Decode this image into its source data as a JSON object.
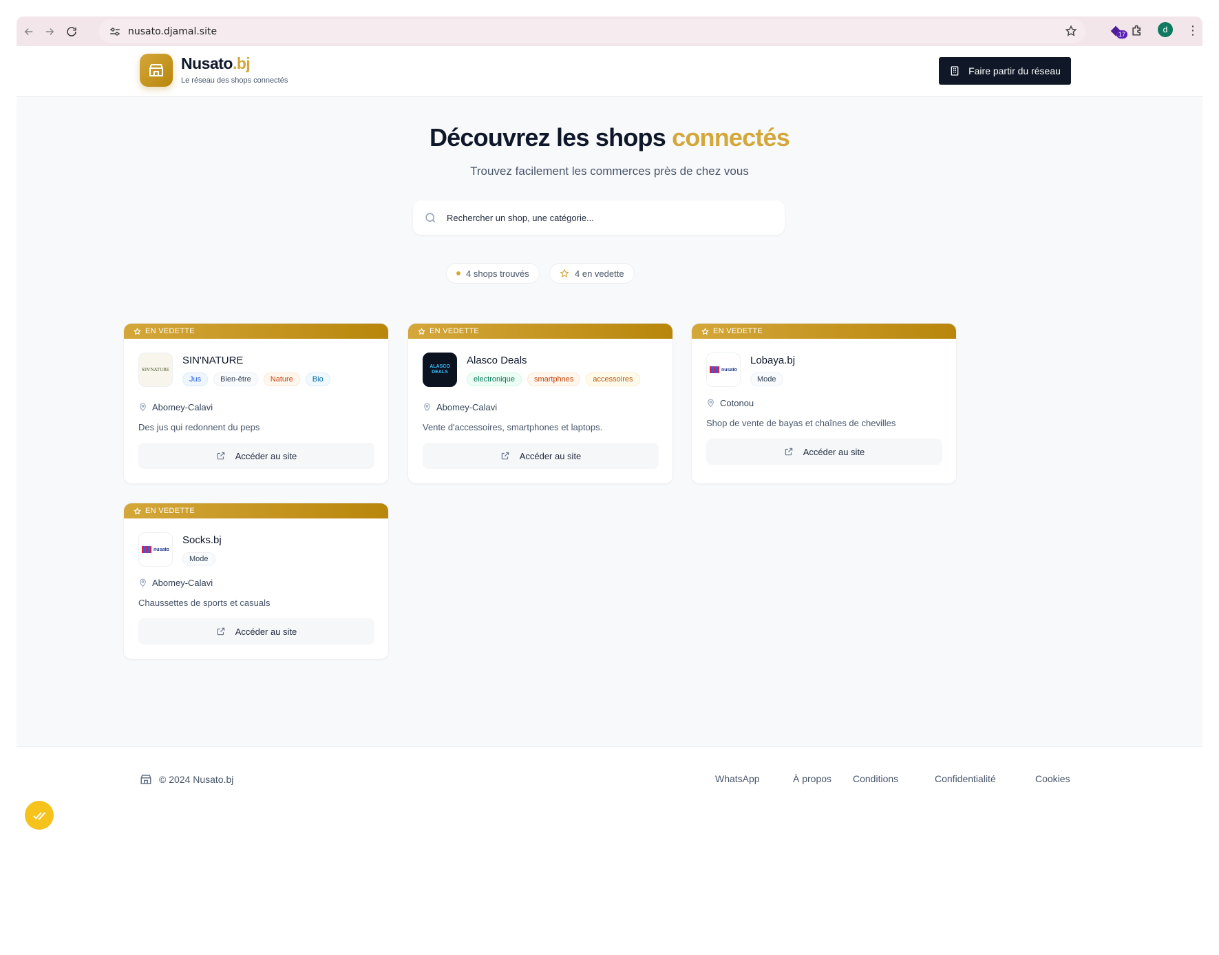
{
  "browser": {
    "url": "nusato.djamal.site",
    "extension_badge": "17",
    "profile_initial": "d"
  },
  "header": {
    "brand_main": "Nusato",
    "brand_suffix": ".bj",
    "tagline": "Le réseau des shops connectés",
    "join_button": "Faire partir du réseau"
  },
  "hero": {
    "title_main": "Découvrez les shops",
    "title_accent": "connectés",
    "subtitle": "Trouvez facilement les commerces près de chez vous",
    "search_placeholder": "Rechercher un shop, une catégorie..."
  },
  "stats": {
    "found": "4 shops trouvés",
    "featured": "4 en vedette"
  },
  "featured_label": "EN VEDETTE",
  "access_label": "Accéder au site",
  "shops": [
    {
      "name": "SIN'NATURE",
      "tags": [
        "Jus",
        "Bien-être",
        "Nature",
        "Bio"
      ],
      "location": "Abomey-Calavi",
      "description": "Des jus qui redonnent du peps",
      "logo_text": "SIN'NATURE"
    },
    {
      "name": "Alasco Deals",
      "tags": [
        "electronique",
        "smartphnes",
        "accessoires"
      ],
      "location": "Abomey-Calavi",
      "description": "Vente d'accessoires, smartphones et laptops.",
      "logo_text": "ALASCO DEALS"
    },
    {
      "name": "Lobaya.bj",
      "tags": [
        "Mode"
      ],
      "location": "Cotonou",
      "description": "Shop de vente de bayas et chaînes de chevilles",
      "logo_text": "nusato"
    },
    {
      "name": "Socks.bj",
      "tags": [
        "Mode"
      ],
      "location": "Abomey-Calavi",
      "description": "Chaussettes de sports et casuals",
      "logo_text": "nusato"
    }
  ],
  "footer": {
    "copyright": "© 2024 Nusato.bj",
    "links": [
      "WhatsApp",
      "À propos",
      "Conditions",
      "Confidentialité",
      "Cookies"
    ]
  },
  "colors": {
    "gold": "#d4a73a",
    "dark": "#101827"
  }
}
